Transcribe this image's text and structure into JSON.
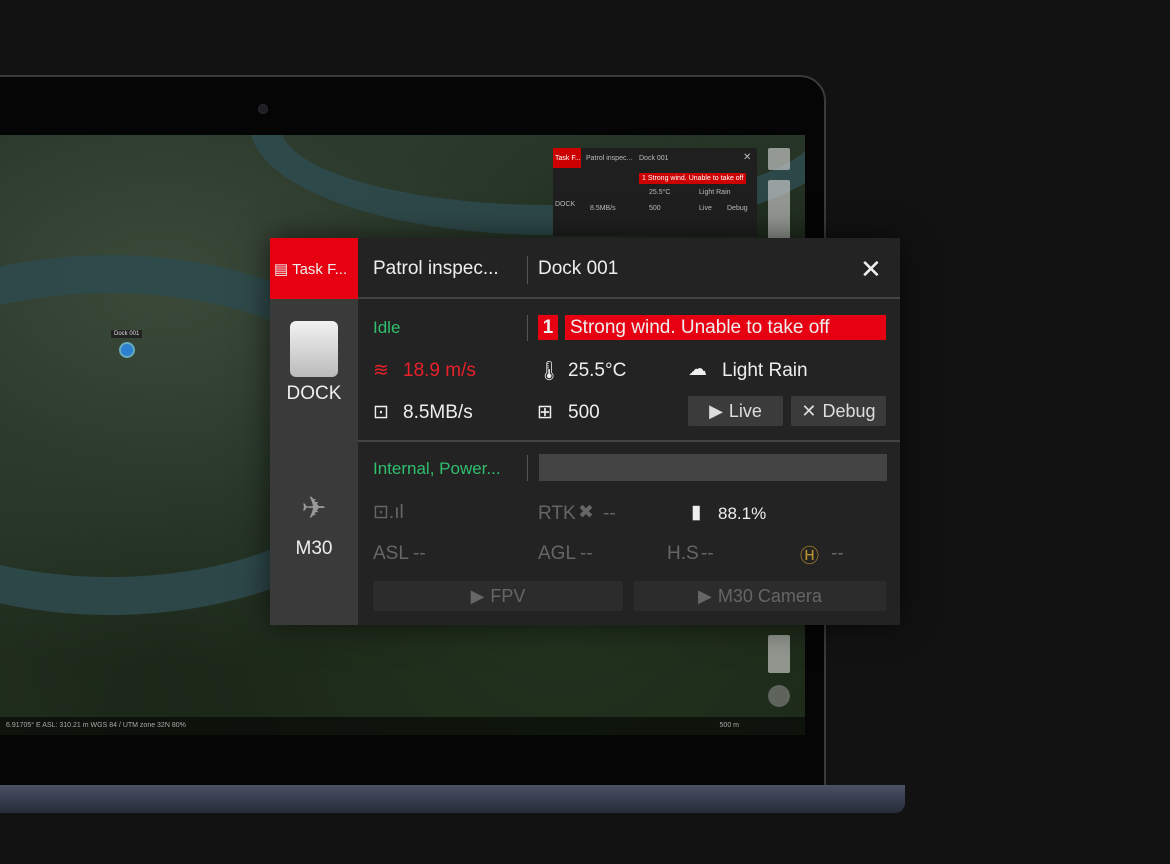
{
  "map": {
    "marker_label": "Dock 001",
    "status_left": "6.91705° E   ASL: 310.21 m   WGS 84 / UTM zone 32N   80%",
    "scale": "500 m"
  },
  "mini_panel": {
    "tab": "Task F...",
    "title": "Patrol inspec...",
    "device": "Dock 001",
    "alert": "1 Strong wind. Unable to take off",
    "temp": "25.5°C",
    "weather": "Light Rain",
    "net": "8.5MB/s",
    "storage": "500",
    "live": "Live",
    "debug": "Debug",
    "dock": "DOCK"
  },
  "panel": {
    "tab_label": "Task F...",
    "task_title": "Patrol inspec...",
    "device_name": "Dock 001",
    "dock": {
      "label": "DOCK",
      "status": "Idle",
      "alert_count": "1",
      "alert_text": "Strong wind. Unable to take off",
      "wind": "18.9 m/s",
      "temperature": "25.5°C",
      "weather": "Light Rain",
      "network": "8.5MB/s",
      "storage": "500",
      "live_button": "Live",
      "debug_button": "Debug"
    },
    "drone": {
      "label": "M30",
      "status": "Internal, Power...",
      "rtk_label": "RTK",
      "rtk_value": "--",
      "battery": "88.1%",
      "asl": "ASL",
      "asl_value": "--",
      "agl": "AGL",
      "agl_value": "--",
      "hs": "H.S",
      "hs_value": "--",
      "home_value": "--",
      "fpv_button": "FPV",
      "camera_button": "M30 Camera"
    }
  },
  "colors": {
    "accent": "#e60012",
    "ok": "#2fbf6e",
    "warning_gold": "#b8922a"
  }
}
